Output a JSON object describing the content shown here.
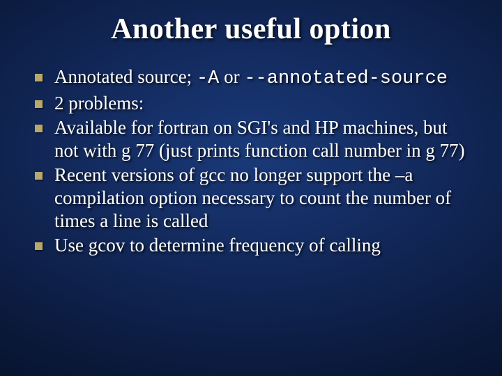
{
  "slide": {
    "title": "Another useful option",
    "bullets": [
      {
        "pre": "Annotated source; ",
        "code1": "-A",
        "mid": " or ",
        "code2": "--annotated-source"
      },
      {
        "text": "2 problems:"
      },
      {
        "text": "Available for fortran on SGI's and HP machines, but not with g 77 (just prints function call number in g 77)"
      },
      {
        "text": "Recent versions of gcc no longer support the –a compilation option necessary to count the number of times a line is called"
      },
      {
        "text": "Use gcov to determine frequency of calling"
      }
    ]
  }
}
